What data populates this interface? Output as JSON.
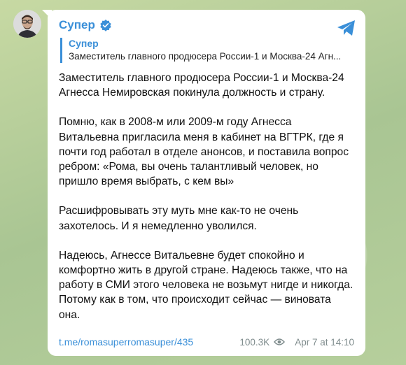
{
  "channel": {
    "name": "Супер",
    "avatar_icon": "person-avatar",
    "verified_icon": "verified-badge-icon",
    "share_icon": "telegram-share-icon"
  },
  "reply": {
    "author": "Супер",
    "text": "Заместитель главного продюсера России-1 и Москва-24 Агн..."
  },
  "message": {
    "paragraphs": [
      "Заместитель главного продюсера России-1 и Москва-24 Агнесса Немировская покинула должность и страну.",
      "Помню, как в 2008-м или 2009-м году Агнесса Витальевна пригласила меня в кабинет на ВГТРК, где я почти год работал в отделе анонсов, и поставила вопрос ребром: «Рома, вы очень талантливый человек, но пришло время выбрать, с кем вы»",
      "Расшифровывать эту муть мне как-то не очень захотелось. И я немедленно уволился.",
      "Надеюсь, Агнессе Витальевне будет спокойно и комфортно жить в другой стране. Надеюсь также, что на работу в СМИ этого человека не возьмут нигде и никогда. Потому как в том, что происходит сейчас — виновата она."
    ]
  },
  "footer": {
    "link": "t.me/romasuperromasuper/435",
    "views": "100.3K",
    "date": "Apr 7 at 14:10"
  },
  "colors": {
    "accent": "#3a8fd8",
    "bubble": "#ffffff"
  }
}
